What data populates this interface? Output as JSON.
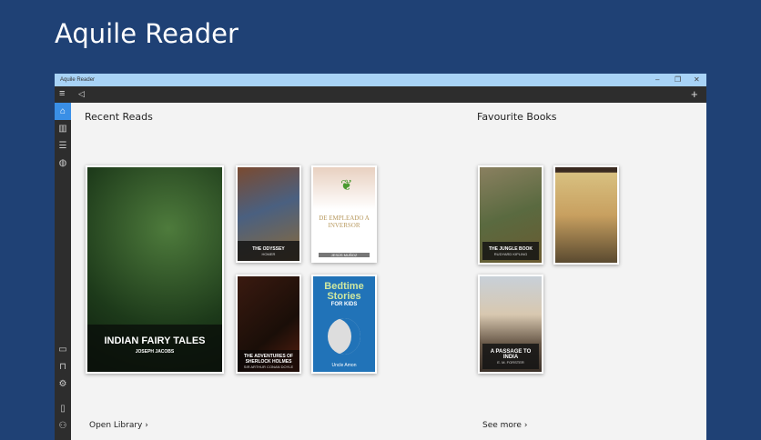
{
  "hero_title": "Aquile Reader",
  "window": {
    "title": "Aquile Reader",
    "minimize": "–",
    "restore": "❐",
    "close": "✕",
    "add": "+"
  },
  "sections": {
    "recent": "Recent Reads",
    "favourites": "Favourite Books",
    "open_library": "Open Library ›",
    "see_more": "See more ›"
  },
  "recent": [
    {
      "title": "INDIAN FAIRY TALES",
      "author": "JOSEPH JACOBS"
    },
    {
      "title": "THE ODYSSEY",
      "author": "HOMER"
    },
    {
      "title": "DE EMPLEADO A INVERSOR",
      "author": "JESÚS MUÑOZ"
    },
    {
      "title": "THE ADVENTURES OF SHERLOCK HOLMES",
      "author": "SIR ARTHUR CONAN DOYLE"
    },
    {
      "title": "Bedtime Stories",
      "subtitle": "FOR KIDS",
      "author": "Uncle Amon"
    }
  ],
  "favourites": [
    {
      "title": "THE JUNGLE BOOK",
      "author": "RUDYARD KIPLING"
    },
    {
      "title": "",
      "author": ""
    },
    {
      "title": "A PASSAGE TO INDIA",
      "author": "E. M. FORSTER"
    }
  ]
}
